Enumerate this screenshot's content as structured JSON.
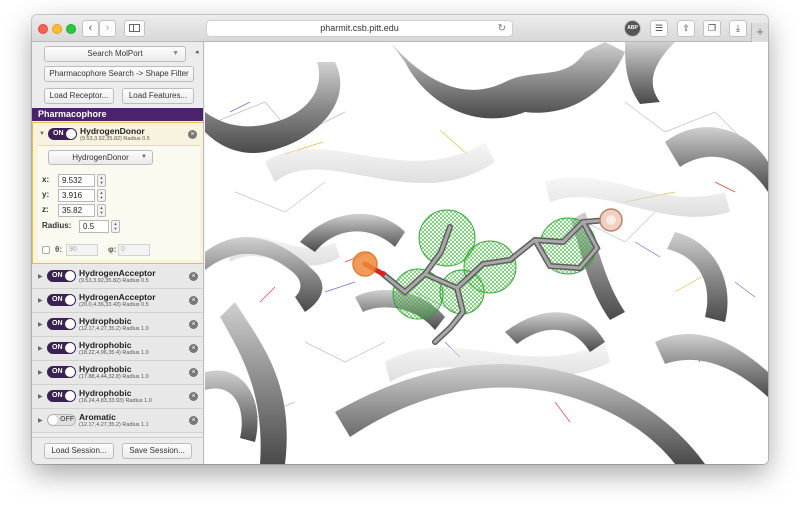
{
  "browser": {
    "url": "pharmit.csb.pitt.edu",
    "back_icon": "chevron-left-icon",
    "forward_icon": "chevron-right-icon",
    "sidebar_toggle_icon": "sidebar-icon",
    "reload_icon": "reload-icon",
    "toolbar_right": [
      {
        "name": "adblock",
        "label": "ABP"
      },
      {
        "name": "extension",
        "label": "ext"
      },
      {
        "name": "share",
        "label": "share"
      },
      {
        "name": "tabs",
        "label": "tabs"
      },
      {
        "name": "download",
        "label": "download"
      }
    ],
    "new_tab_label": "+"
  },
  "sidebar": {
    "search_button": "Search MolPort",
    "filter_button": "Pharmacophore Search -> Shape Filter",
    "load_receptor": "Load Receptor...",
    "load_features": "Load Features...",
    "section_title": "Pharmacophore",
    "collapse_icon": "◂"
  },
  "active_feature": {
    "toggle": "ON",
    "name": "HydrogenDonor",
    "coords": "(9.53,3.92,35.82) Radius 0.5",
    "type_select": "HydrogenDonor",
    "x_label": "x:",
    "x": "9.532",
    "y_label": "y:",
    "y": "3.916",
    "z_label": "z:",
    "z": "35.82",
    "radius_label": "Radius:",
    "radius": "0.5",
    "theta_label": "θ:",
    "theta": "90",
    "phi_label": "φ:",
    "phi": "0"
  },
  "features": [
    {
      "toggle": "ON",
      "name": "HydrogenAcceptor",
      "coords": "(9.53,3.92,35.82) Radius 0.5",
      "on": true
    },
    {
      "toggle": "ON",
      "name": "HydrogenAcceptor",
      "coords": "(20.0,4.36,33.43) Radius 0.5",
      "on": true
    },
    {
      "toggle": "ON",
      "name": "Hydrophobic",
      "coords": "(12.17,4.27,35.2) Radius 1.0",
      "on": true
    },
    {
      "toggle": "ON",
      "name": "Hydrophobic",
      "coords": "(18.22,4.96,35.4) Radius 1.0",
      "on": true
    },
    {
      "toggle": "ON",
      "name": "Hydrophobic",
      "coords": "(17.88,4.44,32.8) Radius 1.0",
      "on": true
    },
    {
      "toggle": "ON",
      "name": "Hydrophobic",
      "coords": "(16.24,4.83,33.93) Radius 1.0",
      "on": true
    },
    {
      "toggle": "OFF",
      "name": "Aromatic",
      "coords": "(12.17,4.27,35.2) Radius 1.1",
      "on": false
    }
  ],
  "session": {
    "load": "Load Session...",
    "save": "Save Session..."
  },
  "colors": {
    "accent": "#4a236c",
    "toggle_on": "#3b2253",
    "highlight_border": "#e0c24a",
    "mesh_green": "#3bbd3b"
  }
}
